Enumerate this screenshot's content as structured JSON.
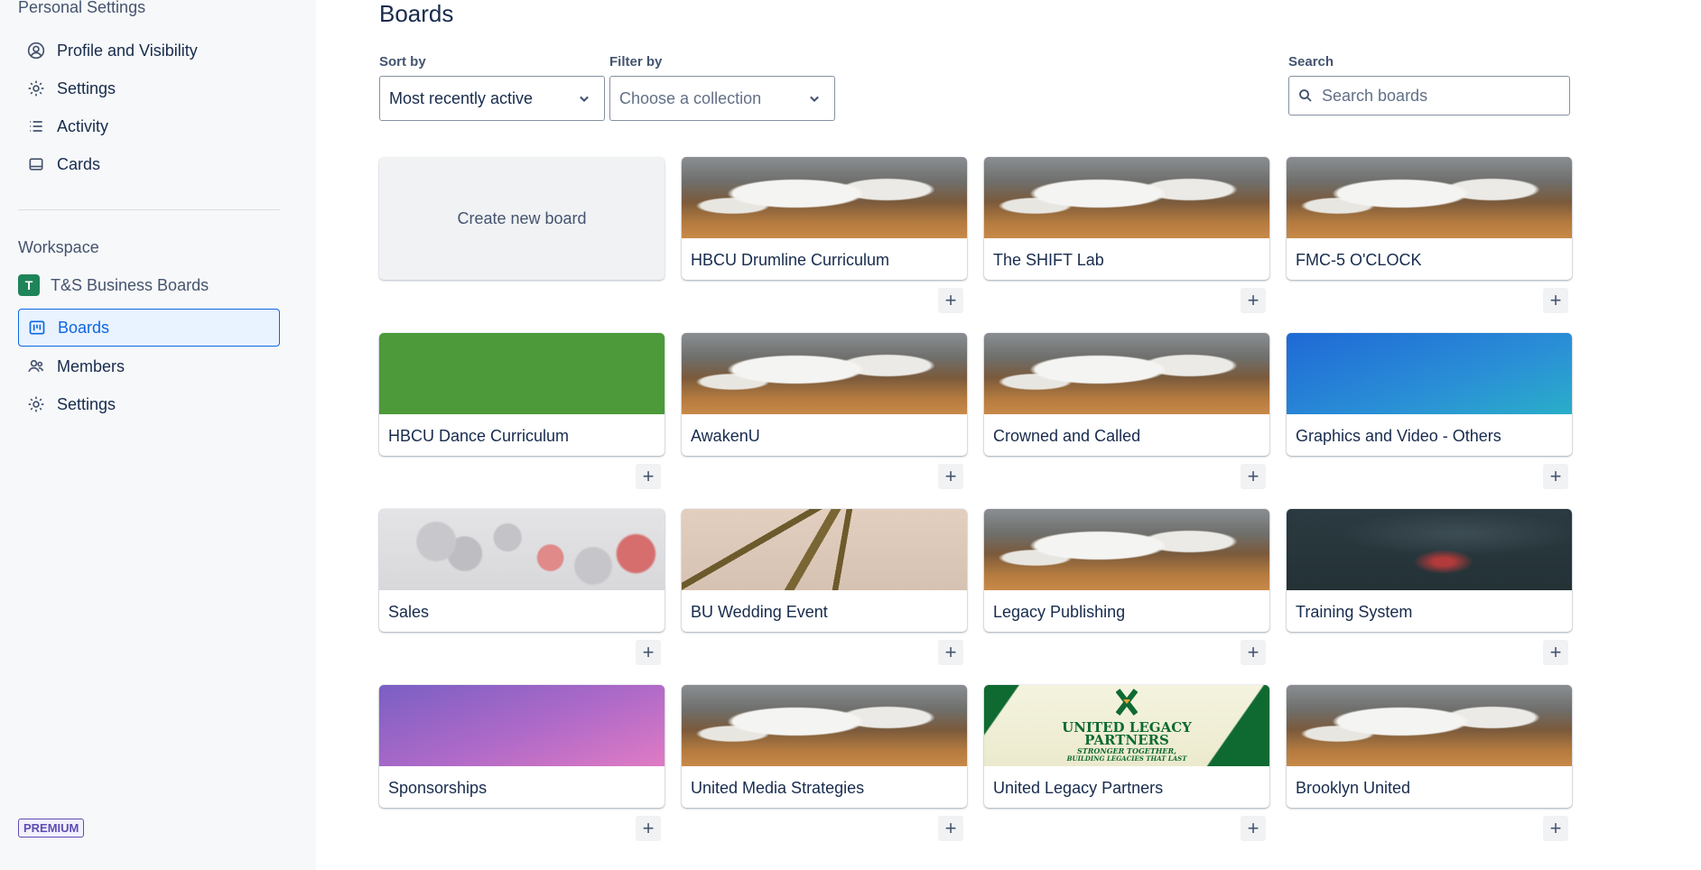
{
  "sidebar": {
    "personal_heading": "Personal Settings",
    "personal_items": [
      {
        "label": "Profile and Visibility",
        "icon": "profile-icon"
      },
      {
        "label": "Settings",
        "icon": "gear-icon"
      },
      {
        "label": "Activity",
        "icon": "activity-list-icon"
      },
      {
        "label": "Cards",
        "icon": "card-icon"
      }
    ],
    "workspace_heading": "Workspace",
    "workspace": {
      "avatar": "T",
      "name": "T&S Business Boards",
      "avatar_color": "#1f845a"
    },
    "workspace_items": [
      {
        "label": "Boards",
        "icon": "boards-icon",
        "active": true
      },
      {
        "label": "Members",
        "icon": "members-icon"
      },
      {
        "label": "Settings",
        "icon": "gear-icon"
      }
    ],
    "badge": "PREMIUM"
  },
  "main": {
    "title": "Boards",
    "sort": {
      "label": "Sort by",
      "value": "Most recently active"
    },
    "filter": {
      "label": "Filter by",
      "placeholder": "Choose a collection"
    },
    "search": {
      "label": "Search",
      "placeholder": "Search boards"
    },
    "create_label": "Create new board",
    "plus": "+",
    "boards": [
      {
        "name": "HBCU Drumline Curriculum",
        "cover": "mountain"
      },
      {
        "name": "The SHIFT Lab",
        "cover": "mountain"
      },
      {
        "name": "FMC-5 O'CLOCK",
        "cover": "mountain"
      },
      {
        "name": "HBCU Dance Curriculum",
        "cover": "green"
      },
      {
        "name": "AwakenU",
        "cover": "mountain"
      },
      {
        "name": "Crowned and Called",
        "cover": "mountain"
      },
      {
        "name": "Graphics and Video - Others",
        "cover": "blue"
      },
      {
        "name": "Sales",
        "cover": "sales"
      },
      {
        "name": "BU Wedding Event",
        "cover": "palm"
      },
      {
        "name": "Legacy Publishing",
        "cover": "mountain"
      },
      {
        "name": "Training System",
        "cover": "night"
      },
      {
        "name": "Sponsorships",
        "cover": "purple"
      },
      {
        "name": "United Media Strategies",
        "cover": "mountain"
      },
      {
        "name": "United Legacy Partners",
        "cover": "ulp",
        "cover_lines": [
          "UNITED LEGACY",
          "PARTNERS",
          "STRONGER TOGETHER,",
          "BUILDING LEGACIES THAT LAST"
        ]
      },
      {
        "name": "Brooklyn United",
        "cover": "mountain"
      }
    ]
  },
  "colors": {
    "accent": "#0c66e4",
    "sidebar_bg": "#f7f8f9",
    "text": "#172b4d"
  }
}
